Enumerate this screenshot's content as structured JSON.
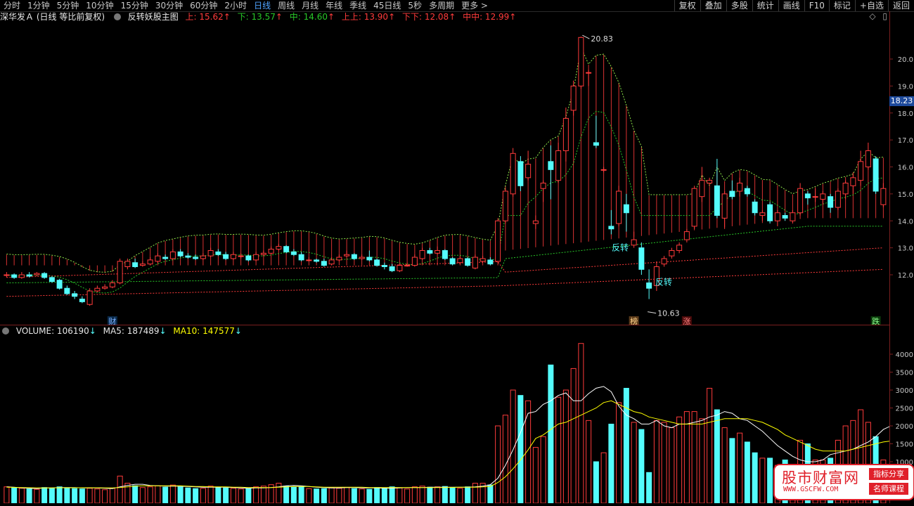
{
  "toolbar": {
    "periods": [
      "分时",
      "1分钟",
      "5分钟",
      "10分钟",
      "15分钟",
      "30分钟",
      "60分钟",
      "2小时",
      "日线",
      "周线",
      "月线",
      "年线",
      "季线",
      "45日线",
      "5秒",
      "多周期",
      "更多 >"
    ],
    "active_period": "日线",
    "tools": [
      "复权",
      "叠加",
      "多股",
      "统计",
      "画线",
      "F10",
      "标记",
      "+自选",
      "返回"
    ]
  },
  "info": {
    "stock": "深华发Ａ",
    "mode": "(日线 等比前复权)",
    "indicator": "反转妖股主图",
    "up_label": "上: 15.62",
    "down_label": "下: 13.57",
    "mid_label": "中: 14.60",
    "upup_label": "上上: 13.90",
    "downdown_label": "下下: 12.08",
    "midmid_label": "中中: 12.99",
    "icon_diamond": "◇",
    "icon_page": "▯"
  },
  "volume_info": {
    "volume_label": "VOLUME: 106190",
    "ma5_label": "MA5: 187489",
    "ma10_label": "MA10: 147577"
  },
  "colors": {
    "up": "#ff3b3b",
    "down": "#54fcfc",
    "ma5": "#ffffff",
    "ma10": "#ffff00",
    "band": "#ff3b3b",
    "mid": "#28c828",
    "accent": "#4fa3ff"
  },
  "annotations": {
    "high_value": "20.83",
    "low_value": "10.63",
    "reversal_text": "反转",
    "marker_cai": "财",
    "marker_bang": "榜",
    "marker_zhang": "涨",
    "marker_die": "跌"
  },
  "price_axis": {
    "ticks": [
      "20.0",
      "19.0",
      "18.0",
      "17.0",
      "16.0",
      "15.0",
      "14.0",
      "13.0",
      "12.0"
    ],
    "current": "18.23"
  },
  "volume_axis": {
    "ticks": [
      "4000",
      "3500",
      "3000",
      "2500",
      "2000",
      "1500",
      "1000"
    ]
  },
  "watermark": {
    "title": "股市财富网",
    "url": "WWW.GSCFW.COM",
    "tag1": "指标分享",
    "tag2": "名师课程"
  },
  "chart_data": {
    "type": "candlestick",
    "price_range": [
      10.5,
      21.0
    ],
    "volume_range_thousands": [
      0,
      4300
    ],
    "high": 20.83,
    "low": 10.63,
    "candles": [
      {
        "o": 12.0,
        "c": 12.0,
        "h": 12.1,
        "l": 11.9,
        "v": 300
      },
      {
        "o": 12.0,
        "c": 11.9,
        "h": 12.05,
        "l": 11.85,
        "v": 280
      },
      {
        "o": 11.9,
        "c": 12.0,
        "h": 12.1,
        "l": 11.85,
        "v": 260
      },
      {
        "o": 12.0,
        "c": 11.95,
        "h": 12.1,
        "l": 11.9,
        "v": 240
      },
      {
        "o": 12.0,
        "c": 12.05,
        "h": 12.1,
        "l": 11.95,
        "v": 230
      },
      {
        "o": 12.05,
        "c": 11.9,
        "h": 12.1,
        "l": 11.85,
        "v": 280
      },
      {
        "o": 11.9,
        "c": 11.75,
        "h": 11.95,
        "l": 11.7,
        "v": 260
      },
      {
        "o": 11.8,
        "c": 11.5,
        "h": 11.85,
        "l": 11.45,
        "v": 300
      },
      {
        "o": 11.5,
        "c": 11.3,
        "h": 11.6,
        "l": 11.25,
        "v": 270
      },
      {
        "o": 11.3,
        "c": 11.2,
        "h": 11.4,
        "l": 11.1,
        "v": 250
      },
      {
        "o": 11.1,
        "c": 11.0,
        "h": 11.2,
        "l": 10.95,
        "v": 240
      },
      {
        "o": 10.9,
        "c": 11.4,
        "h": 11.5,
        "l": 10.85,
        "v": 260
      },
      {
        "o": 11.4,
        "c": 11.5,
        "h": 11.6,
        "l": 11.35,
        "v": 240
      },
      {
        "o": 11.5,
        "c": 11.55,
        "h": 11.65,
        "l": 11.45,
        "v": 220
      },
      {
        "o": 11.55,
        "c": 11.7,
        "h": 11.8,
        "l": 11.5,
        "v": 260
      },
      {
        "o": 11.7,
        "c": 12.5,
        "h": 12.6,
        "l": 11.65,
        "v": 600
      },
      {
        "o": 12.3,
        "c": 12.5,
        "h": 12.6,
        "l": 12.2,
        "v": 400
      },
      {
        "o": 12.45,
        "c": 12.3,
        "h": 12.6,
        "l": 12.25,
        "v": 330
      },
      {
        "o": 12.35,
        "c": 12.4,
        "h": 12.5,
        "l": 12.3,
        "v": 280
      },
      {
        "o": 12.4,
        "c": 12.55,
        "h": 12.65,
        "l": 12.35,
        "v": 300
      },
      {
        "o": 12.5,
        "c": 12.7,
        "h": 12.8,
        "l": 12.45,
        "v": 330
      },
      {
        "o": 12.65,
        "c": 12.6,
        "h": 12.75,
        "l": 12.55,
        "v": 290
      },
      {
        "o": 12.6,
        "c": 12.85,
        "h": 12.95,
        "l": 12.55,
        "v": 350
      },
      {
        "o": 12.85,
        "c": 12.7,
        "h": 12.95,
        "l": 12.65,
        "v": 300
      },
      {
        "o": 12.7,
        "c": 12.65,
        "h": 12.8,
        "l": 12.6,
        "v": 270
      },
      {
        "o": 12.65,
        "c": 12.6,
        "h": 12.75,
        "l": 12.55,
        "v": 250
      },
      {
        "o": 12.6,
        "c": 12.7,
        "h": 12.8,
        "l": 12.55,
        "v": 260
      },
      {
        "o": 12.7,
        "c": 12.9,
        "h": 13.0,
        "l": 12.65,
        "v": 320
      },
      {
        "o": 12.85,
        "c": 12.75,
        "h": 12.95,
        "l": 12.7,
        "v": 290
      },
      {
        "o": 12.75,
        "c": 12.6,
        "h": 12.85,
        "l": 12.55,
        "v": 270
      },
      {
        "o": 12.6,
        "c": 12.75,
        "h": 12.85,
        "l": 12.55,
        "v": 260
      },
      {
        "o": 12.7,
        "c": 12.7,
        "h": 12.8,
        "l": 12.6,
        "v": 240
      },
      {
        "o": 12.7,
        "c": 12.55,
        "h": 12.75,
        "l": 12.5,
        "v": 250
      },
      {
        "o": 12.55,
        "c": 12.75,
        "h": 12.85,
        "l": 12.5,
        "v": 300
      },
      {
        "o": 12.75,
        "c": 12.8,
        "h": 12.9,
        "l": 12.7,
        "v": 320
      },
      {
        "o": 12.8,
        "c": 12.95,
        "h": 13.05,
        "l": 12.75,
        "v": 360
      },
      {
        "o": 12.95,
        "c": 13.05,
        "h": 13.15,
        "l": 12.9,
        "v": 400
      },
      {
        "o": 13.05,
        "c": 12.85,
        "h": 13.1,
        "l": 12.8,
        "v": 320
      },
      {
        "o": 12.85,
        "c": 12.75,
        "h": 12.95,
        "l": 12.7,
        "v": 290
      },
      {
        "o": 12.75,
        "c": 12.55,
        "h": 12.85,
        "l": 12.5,
        "v": 300
      },
      {
        "o": 12.55,
        "c": 12.55,
        "h": 12.65,
        "l": 12.5,
        "v": 250
      },
      {
        "o": 12.55,
        "c": 12.5,
        "h": 12.6,
        "l": 12.45,
        "v": 240
      },
      {
        "o": 12.5,
        "c": 12.35,
        "h": 12.6,
        "l": 12.3,
        "v": 250
      },
      {
        "o": 12.4,
        "c": 12.55,
        "h": 12.65,
        "l": 12.35,
        "v": 270
      },
      {
        "o": 12.55,
        "c": 12.65,
        "h": 12.75,
        "l": 12.5,
        "v": 260
      },
      {
        "o": 12.7,
        "c": 12.75,
        "h": 12.9,
        "l": 12.65,
        "v": 280
      },
      {
        "o": 12.75,
        "c": 12.6,
        "h": 12.8,
        "l": 12.55,
        "v": 250
      },
      {
        "o": 12.6,
        "c": 12.65,
        "h": 12.75,
        "l": 12.55,
        "v": 240
      },
      {
        "o": 12.65,
        "c": 12.55,
        "h": 12.9,
        "l": 12.5,
        "v": 230
      },
      {
        "o": 12.55,
        "c": 12.35,
        "h": 12.6,
        "l": 12.3,
        "v": 280
      },
      {
        "o": 12.35,
        "c": 12.3,
        "h": 12.45,
        "l": 12.2,
        "v": 260
      },
      {
        "o": 12.3,
        "c": 12.15,
        "h": 12.4,
        "l": 12.1,
        "v": 300
      },
      {
        "o": 12.15,
        "c": 12.35,
        "h": 12.4,
        "l": 12.1,
        "v": 270
      },
      {
        "o": 12.35,
        "c": 12.35,
        "h": 12.45,
        "l": 12.3,
        "v": 240
      },
      {
        "o": 12.35,
        "c": 12.65,
        "h": 12.75,
        "l": 12.3,
        "v": 300
      },
      {
        "o": 12.6,
        "c": 12.9,
        "h": 13.0,
        "l": 12.55,
        "v": 320
      },
      {
        "o": 12.9,
        "c": 12.8,
        "h": 13.0,
        "l": 12.75,
        "v": 290
      },
      {
        "o": 12.8,
        "c": 12.9,
        "h": 13.05,
        "l": 12.75,
        "v": 300
      },
      {
        "o": 12.9,
        "c": 12.6,
        "h": 12.95,
        "l": 12.55,
        "v": 310
      },
      {
        "o": 12.6,
        "c": 12.4,
        "h": 12.65,
        "l": 12.35,
        "v": 280
      },
      {
        "o": 12.45,
        "c": 12.6,
        "h": 12.7,
        "l": 12.4,
        "v": 260
      },
      {
        "o": 12.6,
        "c": 12.35,
        "h": 12.65,
        "l": 12.3,
        "v": 300
      },
      {
        "o": 12.25,
        "c": 12.65,
        "h": 12.75,
        "l": 12.2,
        "v": 400
      },
      {
        "o": 12.5,
        "c": 12.6,
        "h": 12.7,
        "l": 12.45,
        "v": 400
      },
      {
        "o": 12.55,
        "c": 12.4,
        "h": 12.65,
        "l": 12.35,
        "v": 350
      },
      {
        "o": 12.5,
        "c": 14.0,
        "h": 14.1,
        "l": 12.45,
        "v": 2000
      },
      {
        "o": 14.0,
        "c": 15.1,
        "h": 15.2,
        "l": 13.9,
        "v": 2300
      },
      {
        "o": 15.0,
        "c": 16.5,
        "h": 16.7,
        "l": 14.9,
        "v": 3000
      },
      {
        "o": 16.2,
        "c": 15.3,
        "h": 16.4,
        "l": 15.1,
        "v": 2850
      },
      {
        "o": 15.6,
        "c": 16.1,
        "h": 16.6,
        "l": 15.5,
        "v": 2700
      },
      {
        "o": 13.9,
        "c": 14.0,
        "h": 14.2,
        "l": 13.7,
        "v": 1400
      },
      {
        "o": 15.2,
        "c": 15.4,
        "h": 15.5,
        "l": 14.7,
        "v": 1700
      },
      {
        "o": 16.2,
        "c": 15.9,
        "h": 16.8,
        "l": 14.8,
        "v": 3700
      },
      {
        "o": 15.5,
        "c": 16.6,
        "h": 16.9,
        "l": 15.4,
        "v": 2800
      },
      {
        "o": 16.6,
        "c": 17.8,
        "h": 18.2,
        "l": 16.2,
        "v": 3000
      },
      {
        "o": 18.1,
        "c": 19.0,
        "h": 19.2,
        "l": 17.9,
        "v": 3600
      },
      {
        "o": 19.0,
        "c": 20.8,
        "h": 20.83,
        "l": 18.9,
        "v": 4300
      },
      {
        "o": 19.5,
        "c": 19.5,
        "h": 19.6,
        "l": 19.0,
        "v": 2150
      },
      {
        "o": 16.9,
        "c": 16.8,
        "h": 17.9,
        "l": 16.7,
        "v": 1000
      },
      {
        "o": 15.9,
        "c": 15.9,
        "h": 16.0,
        "l": 15.8,
        "v": 1250
      },
      {
        "o": 13.8,
        "c": 13.7,
        "h": 14.4,
        "l": 13.5,
        "v": 2050
      },
      {
        "o": 13.9,
        "c": 15.1,
        "h": 15.3,
        "l": 13.8,
        "v": 2650
      },
      {
        "o": 14.6,
        "c": 14.3,
        "h": 15.0,
        "l": 13.6,
        "v": 3050
      },
      {
        "o": 13.1,
        "c": 13.3,
        "h": 13.6,
        "l": 13.0,
        "v": 2100
      },
      {
        "o": 13.0,
        "c": 12.2,
        "h": 13.2,
        "l": 12.0,
        "v": 1900
      },
      {
        "o": 11.7,
        "c": 11.5,
        "h": 12.2,
        "l": 11.1,
        "v": 700
      },
      {
        "o": 11.6,
        "c": 12.3,
        "h": 12.5,
        "l": 11.4,
        "v": 2150
      },
      {
        "o": 12.4,
        "c": 12.6,
        "h": 12.7,
        "l": 12.3,
        "v": 2100
      },
      {
        "o": 12.7,
        "c": 12.9,
        "h": 13.0,
        "l": 12.6,
        "v": 1950
      },
      {
        "o": 12.9,
        "c": 13.1,
        "h": 13.2,
        "l": 12.8,
        "v": 2250
      },
      {
        "o": 13.3,
        "c": 13.6,
        "h": 13.7,
        "l": 13.2,
        "v": 2400
      },
      {
        "o": 13.8,
        "c": 15.2,
        "h": 15.3,
        "l": 13.7,
        "v": 2400
      },
      {
        "o": 14.9,
        "c": 15.5,
        "h": 16.0,
        "l": 14.7,
        "v": 2200
      },
      {
        "o": 15.4,
        "c": 15.5,
        "h": 15.6,
        "l": 15.3,
        "v": 3050
      },
      {
        "o": 15.3,
        "c": 14.2,
        "h": 16.3,
        "l": 14.1,
        "v": 2450
      },
      {
        "o": 14.1,
        "c": 15.0,
        "h": 15.1,
        "l": 13.7,
        "v": 1950
      },
      {
        "o": 15.1,
        "c": 14.9,
        "h": 15.5,
        "l": 14.8,
        "v": 1650
      },
      {
        "o": 15.1,
        "c": 15.4,
        "h": 15.6,
        "l": 14.9,
        "v": 1800
      },
      {
        "o": 15.2,
        "c": 15.0,
        "h": 15.3,
        "l": 14.9,
        "v": 1550
      },
      {
        "o": 14.7,
        "c": 14.3,
        "h": 14.8,
        "l": 14.2,
        "v": 1250
      },
      {
        "o": 14.2,
        "c": 14.3,
        "h": 14.4,
        "l": 14.0,
        "v": 1100
      },
      {
        "o": 14.6,
        "c": 14.0,
        "h": 14.7,
        "l": 13.9,
        "v": 1100
      },
      {
        "o": 14.0,
        "c": 14.3,
        "h": 14.4,
        "l": 13.8,
        "v": 900
      },
      {
        "o": 14.2,
        "c": 14.1,
        "h": 14.3,
        "l": 14.0,
        "v": 1050
      },
      {
        "o": 14.0,
        "c": 14.3,
        "h": 14.4,
        "l": 13.9,
        "v": 700
      },
      {
        "o": 14.3,
        "c": 15.2,
        "h": 15.4,
        "l": 14.2,
        "v": 1600
      },
      {
        "o": 15.0,
        "c": 14.85,
        "h": 15.1,
        "l": 14.6,
        "v": 1500
      },
      {
        "o": 14.9,
        "c": 14.9,
        "h": 15.2,
        "l": 14.7,
        "v": 1050
      },
      {
        "o": 14.8,
        "c": 15.0,
        "h": 15.1,
        "l": 14.6,
        "v": 1050
      },
      {
        "o": 14.9,
        "c": 14.5,
        "h": 15.0,
        "l": 14.3,
        "v": 1100
      },
      {
        "o": 14.5,
        "c": 15.1,
        "h": 15.2,
        "l": 14.4,
        "v": 1600
      },
      {
        "o": 15.0,
        "c": 15.4,
        "h": 15.5,
        "l": 14.8,
        "v": 2000
      },
      {
        "o": 15.3,
        "c": 15.6,
        "h": 15.8,
        "l": 15.0,
        "v": 2150
      },
      {
        "o": 15.5,
        "c": 16.2,
        "h": 16.6,
        "l": 15.3,
        "v": 2450
      },
      {
        "o": 16.0,
        "c": 16.6,
        "h": 16.9,
        "l": 15.9,
        "v": 2100
      },
      {
        "o": 16.3,
        "c": 15.1,
        "h": 16.4,
        "l": 15.0,
        "v": 1700
      },
      {
        "o": 14.6,
        "c": 15.2,
        "h": 15.4,
        "l": 14.5,
        "v": 1050
      }
    ],
    "ma5": [
      300,
      290,
      270,
      260,
      250,
      270,
      270,
      280,
      280,
      280,
      270,
      270,
      270,
      260,
      250,
      300,
      340,
      370,
      370,
      340,
      330,
      320,
      320,
      320,
      310,
      300,
      290,
      290,
      290,
      290,
      280,
      270,
      260,
      270,
      270,
      280,
      300,
      330,
      340,
      330,
      310,
      290,
      280,
      270,
      270,
      280,
      280,
      270,
      270,
      270,
      260,
      260,
      270,
      280,
      280,
      280,
      290,
      290,
      290,
      290,
      290,
      290,
      300,
      320,
      360,
      540,
      900,
      1330,
      1820,
      2350,
      2400,
      2600,
      2700,
      2850,
      2920,
      2700,
      2700,
      2900,
      3050,
      3100,
      2950,
      2550,
      2300,
      2200,
      2050,
      2050,
      2150,
      2000,
      1950,
      2050,
      2050,
      2100,
      2150,
      2250,
      2300,
      2400,
      2350,
      2200,
      2150,
      2000,
      1850,
      1650,
      1450,
      1300,
      1150,
      1050,
      1000,
      1000,
      1050,
      1200,
      1250,
      1300,
      1350,
      1450,
      1550,
      1700,
      1900,
      2000,
      2000,
      1900
    ],
    "ma10": [
      290,
      285,
      280,
      275,
      270,
      270,
      270,
      275,
      275,
      275,
      275,
      275,
      275,
      270,
      270,
      280,
      300,
      320,
      330,
      330,
      330,
      330,
      330,
      330,
      320,
      310,
      310,
      300,
      300,
      300,
      290,
      290,
      280,
      280,
      280,
      280,
      290,
      300,
      310,
      310,
      310,
      300,
      290,
      290,
      290,
      290,
      290,
      290,
      280,
      280,
      280,
      280,
      280,
      280,
      280,
      280,
      280,
      280,
      280,
      285,
      290,
      290,
      290,
      300,
      310,
      420,
      580,
      800,
      1050,
      1330,
      1650,
      1750,
      1900,
      2050,
      2100,
      2200,
      2300,
      2400,
      2500,
      2650,
      2700,
      2600,
      2500,
      2400,
      2350,
      2250,
      2200,
      2150,
      2100,
      2050,
      2050,
      2050,
      2050,
      2100,
      2150,
      2200,
      2200,
      2200,
      2200,
      2150,
      2100,
      2000,
      1900,
      1750,
      1650,
      1550,
      1450,
      1350,
      1300,
      1300,
      1300,
      1300,
      1350,
      1400,
      1450,
      1500,
      1550,
      1580,
      1600,
      1550
    ]
  }
}
